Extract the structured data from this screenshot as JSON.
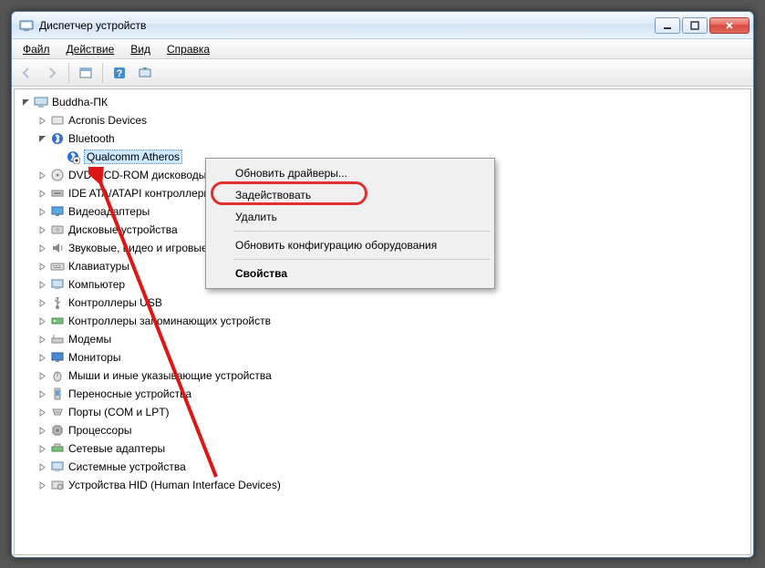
{
  "window": {
    "title": "Диспетчер устройств"
  },
  "menubar": {
    "file": "Файл",
    "action": "Действие",
    "view": "Вид",
    "help": "Справка"
  },
  "tree": {
    "root": "Buddha-ПК",
    "acronis": "Acronis Devices",
    "bluetooth": "Bluetooth",
    "bt_device": "Qualcomm Atheros",
    "dvd": "DVD и CD-ROM дисководы",
    "ide": "IDE ATA/ATAPI контроллеры",
    "video": "Видеоадаптеры",
    "disk": "Дисковые устройства",
    "audio": "Звуковые, видео и игровые устройства",
    "keyboard": "Клавиатуры",
    "computer": "Компьютер",
    "usb": "Контроллеры USB",
    "storage": "Контроллеры запоминающих устройств",
    "modem": "Модемы",
    "monitor": "Мониторы",
    "mouse": "Мыши и иные указывающие устройства",
    "portable": "Переносные устройства",
    "ports": "Порты (COM и LPT)",
    "cpu": "Процессоры",
    "net": "Сетевые адаптеры",
    "system": "Системные устройства",
    "hid": "Устройства HID (Human Interface Devices)"
  },
  "context_menu": {
    "update_drivers": "Обновить драйверы...",
    "enable": "Задействовать",
    "delete": "Удалить",
    "scan": "Обновить конфигурацию оборудования",
    "properties": "Свойства"
  }
}
